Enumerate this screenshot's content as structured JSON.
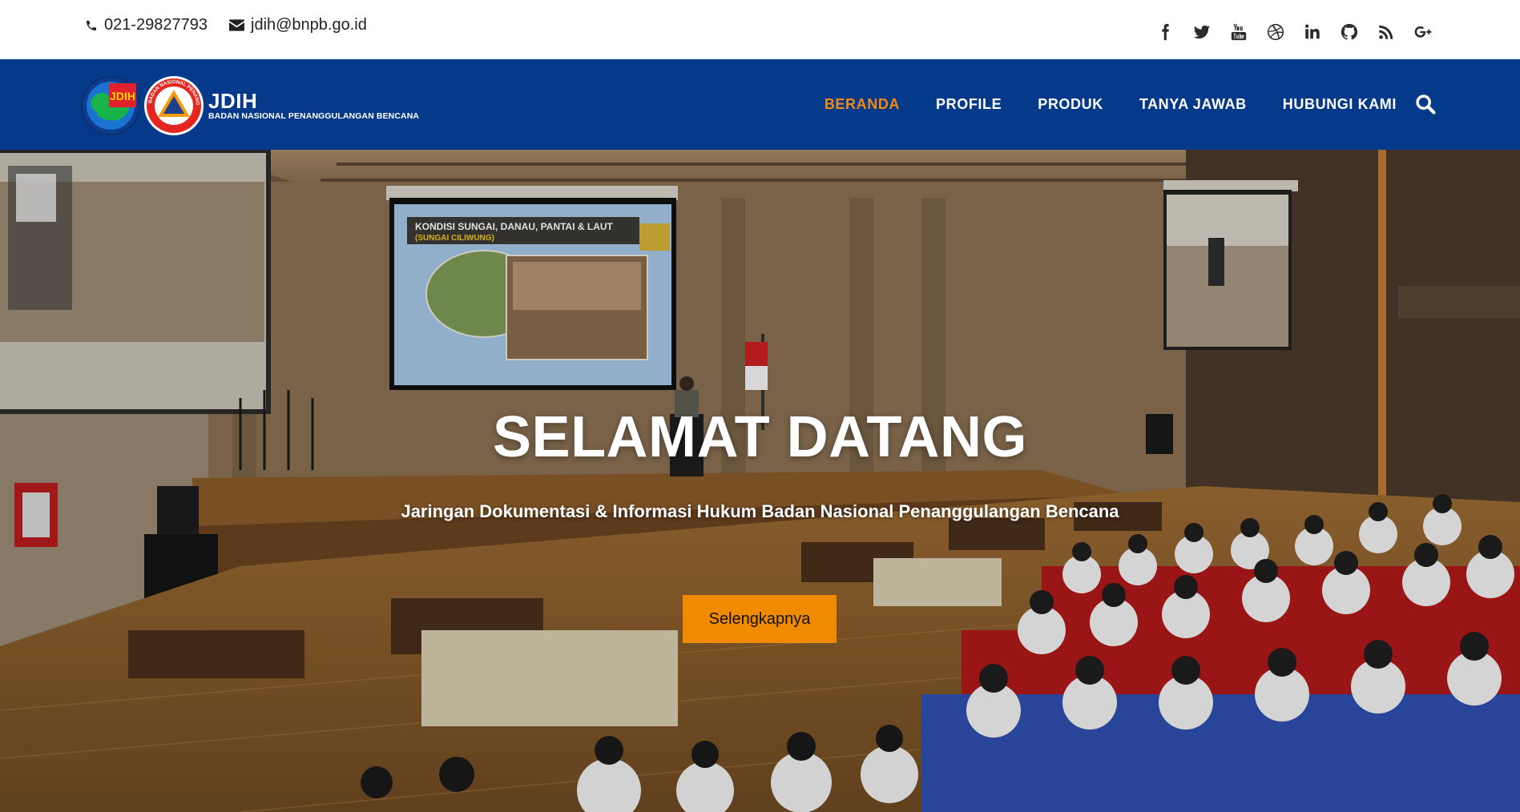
{
  "topbar": {
    "phone": "021-29827793",
    "email": "jdih@bnpb.go.id",
    "socials": [
      "facebook-icon",
      "twitter-icon",
      "youtube-icon",
      "dribbble-icon",
      "linkedin-icon",
      "github-icon",
      "rss-icon",
      "google-plus-icon"
    ]
  },
  "brand": {
    "title": "JDIH",
    "subtitle": "BADAN NASIONAL PENANGGULANGAN BENCANA",
    "emblem_text": "JDIH",
    "seal_text": "BADAN NASIONAL PENANGGULANGAN BENCANA"
  },
  "nav": {
    "items": [
      {
        "label": "BERANDA",
        "active": true
      },
      {
        "label": "PROFILE",
        "active": false
      },
      {
        "label": "PRODUK",
        "active": false
      },
      {
        "label": "TANYA JAWAB",
        "active": false
      },
      {
        "label": "HUBUNGI KAMI",
        "active": false
      }
    ],
    "search_icon": "search-icon"
  },
  "hero": {
    "title": "SELAMAT DATANG",
    "subtitle": "Jaringan Dokumentasi & Informasi Hukum Badan Nasional Penanggulangan Bencana",
    "button_label": "Selengkapnya",
    "slide_title": "KONDISI SUNGAI, DANAU, PANTAI & LAUT",
    "slide_subtitle": "(SUNGAI CILIWUNG)"
  },
  "colors": {
    "navbar": "#053a8a",
    "accent": "#f08a14",
    "button": "#f08a00"
  }
}
